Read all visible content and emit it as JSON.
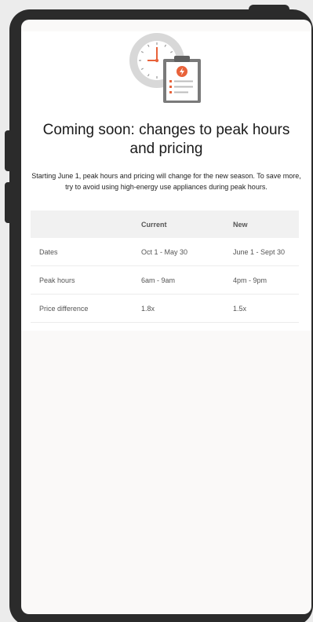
{
  "notice": {
    "title": "Coming soon: changes to peak hours and pricing",
    "description": "Starting June 1, peak hours and pricing will change for the new season. To save more, try to avoid using high-energy use appliances during peak hours."
  },
  "table": {
    "headers": [
      "",
      "Current",
      "New"
    ],
    "rows": [
      [
        "Dates",
        "Oct 1 - May 30",
        "June 1 - Sept 30"
      ],
      [
        "Peak hours",
        "6am - 9am",
        "4pm - 9pm"
      ],
      [
        "Price difference",
        "1.8x",
        "1.5x"
      ]
    ]
  },
  "icons": {
    "illustration": "clock-and-clipboard-icon"
  },
  "colors": {
    "accent": "#e8623a",
    "clock_face": "#d8d8d8",
    "clipboard_frame": "#7a7a7a"
  }
}
